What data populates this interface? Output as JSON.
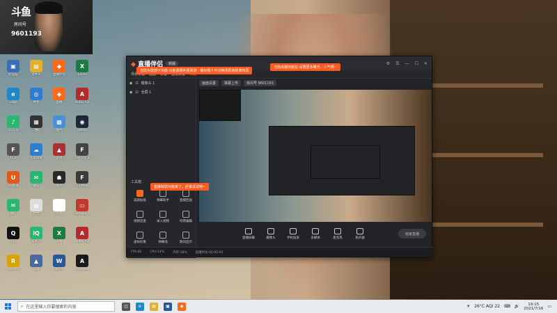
{
  "webcam": {
    "logo": "斗鱼",
    "room_label": "房间号",
    "room_number": "9601193"
  },
  "desktop": {
    "icons": [
      {
        "label": "此电脑",
        "glyph": "▣",
        "color": "#3a6fb8",
        "col": 0,
        "row": 0
      },
      {
        "label": "文件夹",
        "glyph": "▤",
        "color": "#e0b030",
        "col": 1,
        "row": 0
      },
      {
        "label": "直播伴侣",
        "glyph": "◆",
        "color": "#ff6a1a",
        "col": 2,
        "row": 0
      },
      {
        "label": "Excel",
        "glyph": "X",
        "color": "#1d7a43",
        "col": 3,
        "row": 0
      },
      {
        "label": "Edge",
        "glyph": "e",
        "color": "#1e88c9",
        "col": 0,
        "row": 1
      },
      {
        "label": "共享",
        "glyph": "◎",
        "color": "#2f7dd1",
        "col": 1,
        "row": 1
      },
      {
        "label": "直播",
        "glyph": "◆",
        "color": "#ff6a1a",
        "col": 2,
        "row": 1
      },
      {
        "label": "AutoCAD",
        "glyph": "A",
        "color": "#b52b2b",
        "col": 3,
        "row": 1
      },
      {
        "label": "QQ音乐",
        "glyph": "♪",
        "color": "#2bb673",
        "col": 0,
        "row": 2
      },
      {
        "label": "二维码",
        "glyph": "▦",
        "color": "#333333",
        "col": 1,
        "row": 2
      },
      {
        "label": "图片",
        "glyph": "▩",
        "color": "#4a90d9",
        "col": 2,
        "row": 2
      },
      {
        "label": "Steam",
        "glyph": "◉",
        "color": "#1b2838",
        "col": 3,
        "row": 2
      },
      {
        "label": "FC3",
        "glyph": "F",
        "color": "#555555",
        "col": 0,
        "row": 3
      },
      {
        "label": "百度网盘",
        "glyph": "☁",
        "color": "#2f7dd1",
        "col": 1,
        "row": 3
      },
      {
        "label": "游戏",
        "glyph": "▲",
        "color": "#a83232",
        "col": 2,
        "row": 3
      },
      {
        "label": "Far Cry 3",
        "glyph": "F",
        "color": "#444444",
        "col": 3,
        "row": 3
      },
      {
        "label": "UU加速",
        "glyph": "U",
        "color": "#e05a1a",
        "col": 0,
        "row": 4
      },
      {
        "label": "微信",
        "glyph": "✉",
        "color": "#2bb673",
        "col": 1,
        "row": 4
      },
      {
        "label": "狼人",
        "glyph": "☗",
        "color": "#2a2a2a",
        "col": 2,
        "row": 4
      },
      {
        "label": "FC3 Maps",
        "glyph": "F",
        "color": "#3a3a3a",
        "col": 3,
        "row": 4
      },
      {
        "label": "微信",
        "glyph": "✉",
        "color": "#2bb673",
        "col": 0,
        "row": 5
      },
      {
        "label": "文档",
        "glyph": "▤",
        "color": "#dddddd",
        "col": 1,
        "row": 5
      },
      {
        "label": "画图",
        "glyph": "✎",
        "color": "#ffffff",
        "col": 2,
        "row": 5
      },
      {
        "label": "Drawing1",
        "glyph": "▭",
        "color": "#c0392b",
        "col": 3,
        "row": 5
      },
      {
        "label": "QQ",
        "glyph": "Q",
        "color": "#111111",
        "col": 0,
        "row": 6
      },
      {
        "label": "爱奇艺",
        "glyph": "iQ",
        "color": "#2bb673",
        "col": 1,
        "row": 6
      },
      {
        "label": "表格",
        "glyph": "X",
        "color": "#1d7a43",
        "col": 2,
        "row": 6
      },
      {
        "label": "AutoCAD",
        "glyph": "A",
        "color": "#b52b2b",
        "col": 3,
        "row": 6
      },
      {
        "label": "Rockstar",
        "glyph": "R",
        "color": "#d9a400",
        "col": 0,
        "row": 7
      },
      {
        "label": "游戏",
        "glyph": "▲",
        "color": "#4a6a9c",
        "col": 1,
        "row": 7
      },
      {
        "label": "Word",
        "glyph": "W",
        "color": "#2b5797",
        "col": 2,
        "row": 7
      },
      {
        "label": "Autodesk",
        "glyph": "A",
        "color": "#1a1a1a",
        "col": 3,
        "row": 7
      }
    ]
  },
  "app": {
    "title": "直播伴侣",
    "version": "新版",
    "tip1": "当前为需部分功能·功能需顺利更新流 · 最标题人可切换改原来经典布局",
    "tip2": "当前为大房间·切换管理直播",
    "tip3": "当前点播功能在·设置更多曝光、人气啊~",
    "subbar_items": [
      "场景管理",
      "画面",
      "设置",
      "直播设置",
      "工具"
    ],
    "scenes": [
      "摄像头 1",
      "全屏 1"
    ],
    "tools_title": "工具箱",
    "tools": [
      {
        "label": "美颜贴纸",
        "orange": true
      },
      {
        "label": "弹幕助手",
        "orange": false
      },
      {
        "label": "直播回放",
        "orange": false
      },
      {
        "label": "视频连麦",
        "orange": false
      },
      {
        "label": "录入视频",
        "orange": false
      },
      {
        "label": "场景编辑",
        "orange": false
      },
      {
        "label": "虚拟形象",
        "orange": false
      },
      {
        "label": "弹幕墙",
        "orange": false
      },
      {
        "label": "歌词显示",
        "orange": false
      }
    ],
    "orange_tip": "直播有助功能来了，赶紧试试吧~",
    "topinfo": [
      "画面设置",
      "弹幕上传",
      "房间号 9601193"
    ],
    "controls": [
      "直播屏幕",
      "摄像头",
      "手机投屏",
      "多媒体",
      "麦克风",
      "扬声器"
    ],
    "start_label": "结束直播",
    "status": [
      "FPS:60",
      "CPU:14%",
      "内存:38%",
      "直播时长:00:00:00"
    ]
  },
  "taskbar": {
    "search_placeholder": "在这里输入你要搜索的内容",
    "weather": "26°C AQI 22",
    "time": "19:15",
    "date": "2021/7/16"
  }
}
